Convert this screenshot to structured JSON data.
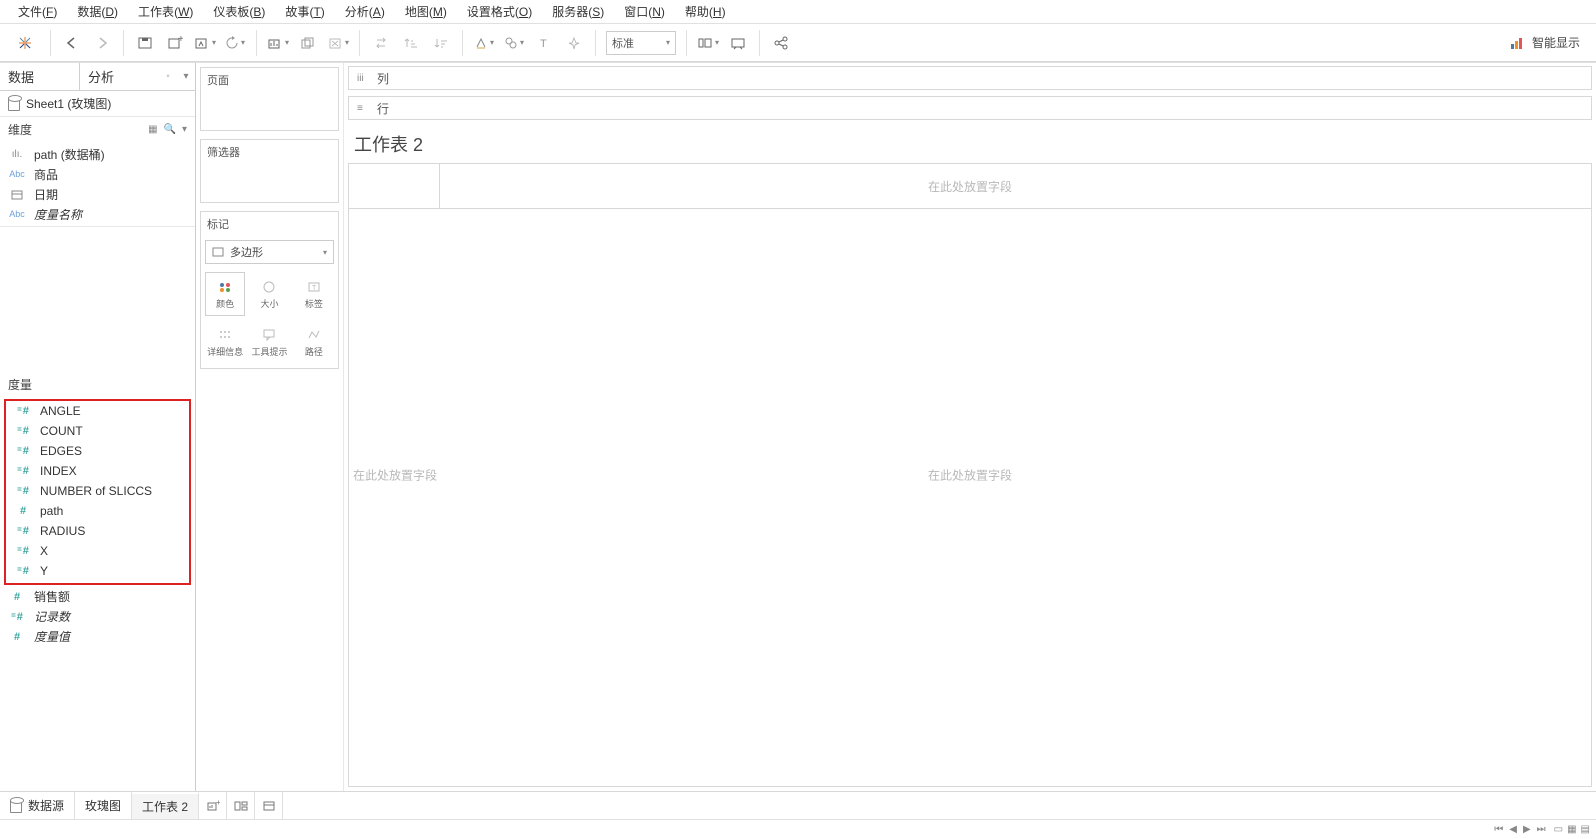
{
  "menubar": {
    "items": [
      {
        "label": "文件",
        "u": "F"
      },
      {
        "label": "数据",
        "u": "D"
      },
      {
        "label": "工作表",
        "u": "W"
      },
      {
        "label": "仪表板",
        "u": "B"
      },
      {
        "label": "故事",
        "u": "T"
      },
      {
        "label": "分析",
        "u": "A"
      },
      {
        "label": "地图",
        "u": "M"
      },
      {
        "label": "设置格式",
        "u": "O"
      },
      {
        "label": "服务器",
        "u": "S"
      },
      {
        "label": "窗口",
        "u": "N"
      },
      {
        "label": "帮助",
        "u": "H"
      }
    ]
  },
  "toolbar": {
    "fit_select": "标准",
    "showme": "智能显示"
  },
  "sidebar": {
    "tabs": {
      "data": "数据",
      "analysis": "分析"
    },
    "datasource": "Sheet1 (玫瑰图)",
    "dimensions": {
      "title": "维度",
      "fields": [
        {
          "icon": "bars",
          "label": "path (数据桶)",
          "italic": false
        },
        {
          "icon": "abc",
          "label": "商品",
          "italic": false
        },
        {
          "icon": "cal",
          "label": "日期",
          "italic": false
        },
        {
          "icon": "abc",
          "label": "度量名称",
          "italic": true
        }
      ]
    },
    "measures": {
      "title": "度量",
      "highlighted": [
        "ANGLE",
        "COUNT",
        "EDGES",
        "INDEX",
        "NUMBER of SLICCS",
        "path",
        "RADIUS",
        "X",
        "Y"
      ],
      "others": [
        {
          "label": "销售额",
          "icon": "hash",
          "italic": false
        },
        {
          "label": "记录数",
          "icon": "hash-eq",
          "italic": true
        },
        {
          "label": "度量值",
          "icon": "hash",
          "italic": true
        }
      ]
    }
  },
  "shelves": {
    "pages": "页面",
    "filters": "筛选器",
    "marks": {
      "title": "标记",
      "type": "多边形",
      "cells": [
        "颜色",
        "大小",
        "标签",
        "详细信息",
        "工具提示",
        "路径"
      ]
    },
    "columns": "列",
    "rows": "行"
  },
  "canvas": {
    "title": "工作表 2",
    "drop_hint": "在此处放置字段"
  },
  "status": {
    "datasource": "数据源",
    "tabs": [
      "玫瑰图",
      "工作表 2"
    ]
  }
}
